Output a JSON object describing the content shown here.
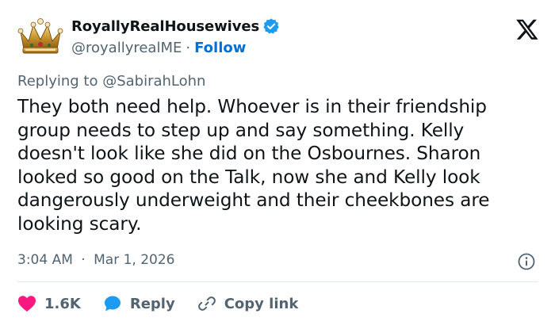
{
  "header": {
    "display_name": "RoyallyRealHousewives",
    "handle": "@royallyrealME",
    "separator": "·",
    "follow_label": "Follow"
  },
  "tweet": {
    "replying_prefix": "Replying to ",
    "replying_to": "@SabirahLohn",
    "text": "They both need help. Whoever is in their friendship group needs to step up and say something. Kelly doesn't look like she did on the Osbournes. Sharon looked so good on the Talk, now she and Kelly look dangerously underweight and their cheekbones are looking scary.",
    "time": "3:04 AM",
    "separator": "·",
    "date": "Mar 1, 2026"
  },
  "actions": {
    "like_count": "1.6K",
    "reply_label": "Reply",
    "copy_link_label": "Copy link"
  },
  "icons": {
    "avatar": "crown-avatar",
    "verified": "verified-badge-icon",
    "logo": "x-logo-icon",
    "info": "info-icon",
    "like": "heart-icon",
    "reply": "reply-bubble-icon",
    "link": "link-icon"
  },
  "colors": {
    "accent": "#1d9bf0",
    "follow": "#006fd6",
    "like": "#f91880",
    "muted": "#536471",
    "text": "#0f1419"
  }
}
